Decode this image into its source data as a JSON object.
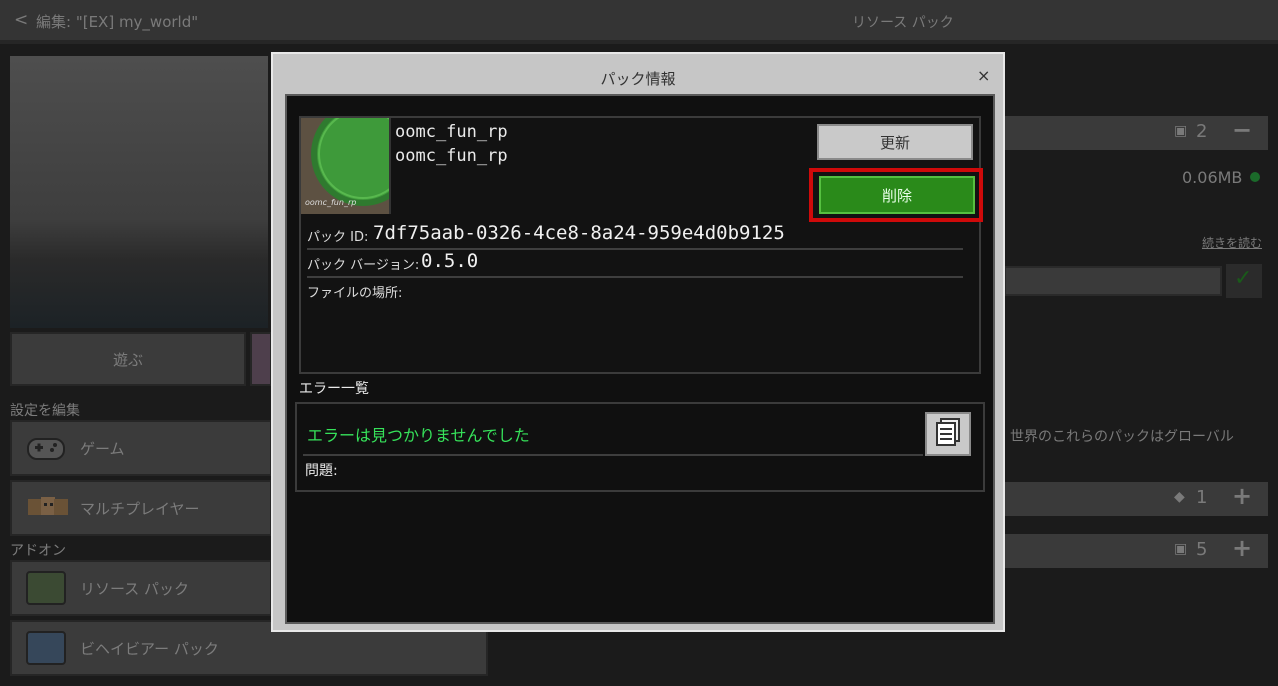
{
  "header": {
    "back_glyph": "<",
    "title": "編集: \"[EX] my_world\"",
    "right_title": "リソース パック"
  },
  "left_pane": {
    "play_label": "遊ぶ",
    "settings_section": "設定を編集",
    "game_label": "ゲーム",
    "multiplayer_label": "マルチプレイヤー",
    "addons_section": "アドオン",
    "resource_pack_label": "リソース パック",
    "behavior_pack_label": "ビヘイビアー パック"
  },
  "right_pane": {
    "count1": "2",
    "size": "0.06MB",
    "read_more": "続きを読む",
    "global_text": "世界のこれらのパックはグローバル",
    "count2": "1",
    "count3": "5"
  },
  "dialog": {
    "title": "パック情報",
    "close_glyph": "×",
    "thumb_caption": "oomc_fun_rp",
    "pack_name": "oomc_fun_rp",
    "pack_desc": "oomc_fun_rp",
    "update_label": "更新",
    "delete_label": "削除",
    "pack_id_label": "パック ID:",
    "pack_id_value": "7df75aab-0326-4ce8-8a24-959e4d0b9125",
    "version_label": "パック バージョン:",
    "version_value": "0.5.0",
    "location_label": "ファイルの場所:",
    "error_heading": "エラー一覧",
    "no_errors": "エラーは見つかりませんでした",
    "issues_label": "問題:"
  },
  "colors": {
    "delete_green": "#2a8a1a",
    "highlight_red": "#cf0a0a",
    "ok_text_green": "#36e25a"
  },
  "icons": [
    "chevron-left-icon",
    "controller-icon",
    "players-icon",
    "pack-thumbnail-icon",
    "clipboard-icon",
    "check-icon",
    "minus-icon",
    "plus-icon"
  ]
}
